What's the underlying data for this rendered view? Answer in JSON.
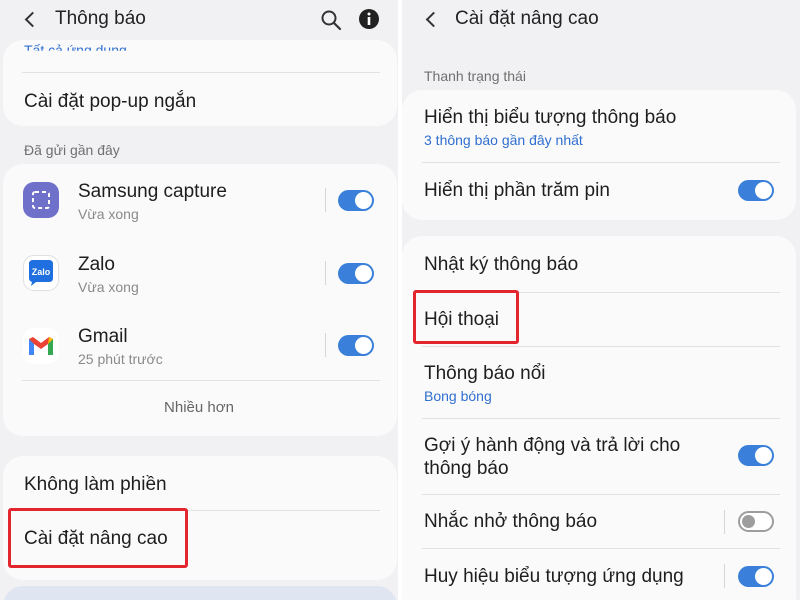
{
  "left": {
    "header": {
      "title": "Thông báo"
    },
    "clipped_text": "Tất cả ứng dụng",
    "popup_settings": "Cài đặt pop-up ngắn",
    "recent_label": "Đã gửi gần đây",
    "apps": [
      {
        "name": "Samsung capture",
        "time": "Vừa xong",
        "enabled": true
      },
      {
        "name": "Zalo",
        "time": "Vừa xong",
        "enabled": true,
        "icon_text": "Zalo"
      },
      {
        "name": "Gmail",
        "time": "25 phút trước",
        "enabled": true
      }
    ],
    "more": "Nhiều hơn",
    "dnd": "Không làm phiền",
    "advanced": "Cài đặt nâng cao"
  },
  "right": {
    "header": {
      "title": "Cài đặt nâng cao"
    },
    "status_bar_label": "Thanh trạng thái",
    "show_icons": {
      "title": "Hiển thị biểu tượng thông báo",
      "sub": "3 thông báo gần đây nhất"
    },
    "battery_percent": {
      "title": "Hiển thị phần trăm pin",
      "enabled": true
    },
    "history": "Nhật ký thông báo",
    "conversations": "Hội thoại",
    "floating": {
      "title": "Thông báo nổi",
      "sub": "Bong bóng"
    },
    "suggest": {
      "line1": "Gợi ý hành động và trả lời cho",
      "line2": "thông báo",
      "enabled": true
    },
    "reminders": {
      "title": "Nhắc nhở thông báo",
      "enabled": false
    },
    "badges": {
      "title": "Huy hiệu biểu tượng ứng dụng",
      "enabled": true
    }
  },
  "colors": {
    "accent": "#3a7fd9",
    "highlight": "#e3262d",
    "link": "#2f6fcf"
  }
}
